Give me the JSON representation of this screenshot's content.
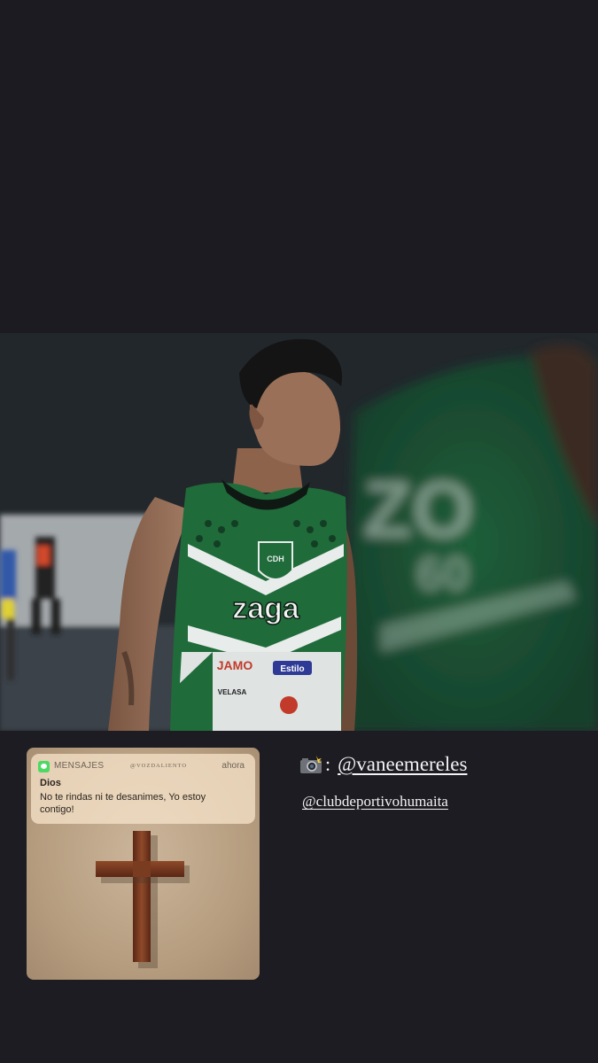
{
  "notification": {
    "app_name": "MENSAJES",
    "handle": "@VOZDALIENTO",
    "time": "ahora",
    "sender": "Dios",
    "message": "No te rindas ni te desanimes, Yo estoy contigo!"
  },
  "jersey": {
    "brand": "zaga",
    "sponsor_1": "JAMO",
    "sponsor_2": "Estilo",
    "sponsor_3": "VELASA"
  },
  "credits": {
    "camera_icon": "camera-flash-icon",
    "separator": ":",
    "photographer": "@vaneemereles",
    "club": "@clubdeportivohumaita"
  },
  "colors": {
    "background": "#1c1c22",
    "jersey_green": "#1f6b3a",
    "text": "#f3f3f3"
  }
}
